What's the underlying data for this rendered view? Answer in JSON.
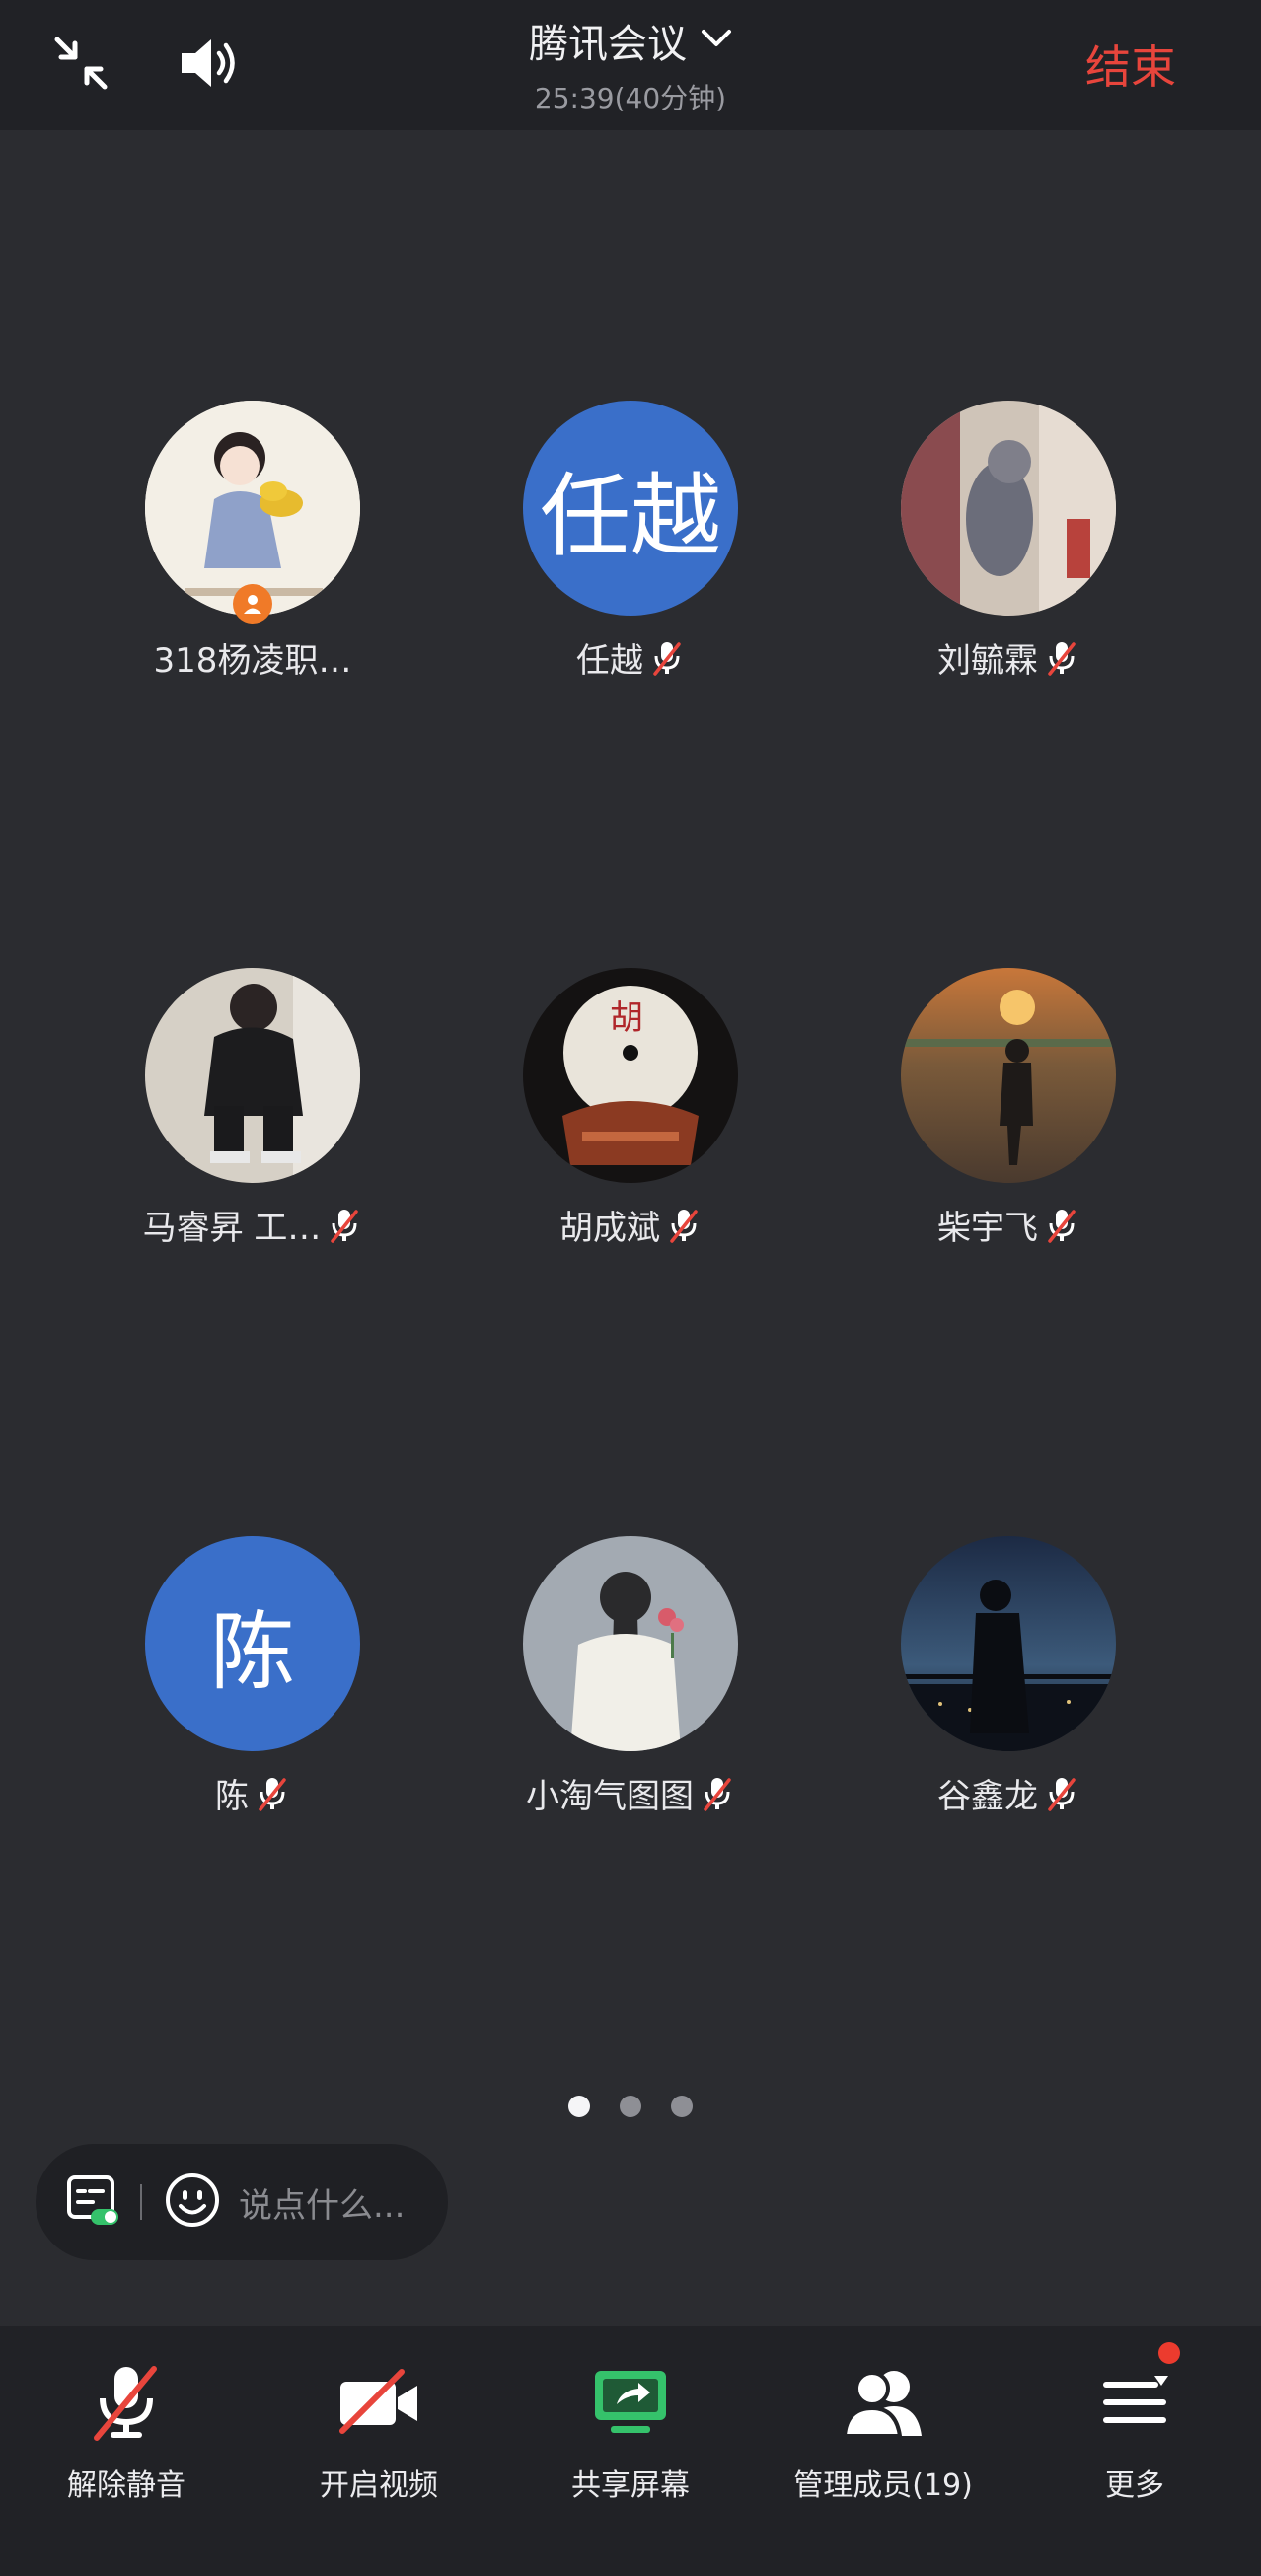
{
  "header": {
    "title": "腾讯会议",
    "duration": "25:39(40分钟)",
    "end_label": "结束"
  },
  "participants": [
    {
      "name": "318杨凌职…",
      "avatar": "photo",
      "avatar_desc": "illustrated girl with gold",
      "muted": false,
      "host": true
    },
    {
      "name": "任越",
      "avatar_text": "任越",
      "muted": true
    },
    {
      "name": "刘毓霖",
      "avatar": "photo",
      "avatar_desc": "cat photo",
      "muted": true
    },
    {
      "name": "马睿昇 工…",
      "avatar": "photo",
      "avatar_desc": "person sitting",
      "muted": true
    },
    {
      "name": "胡成斌",
      "avatar": "photo",
      "avatar_desc": "chinese disc emblem",
      "muted": true
    },
    {
      "name": "柴宇飞",
      "avatar": "photo",
      "avatar_desc": "sunset silhouette",
      "muted": true
    },
    {
      "name": "陈",
      "avatar_text": "陈",
      "muted": true
    },
    {
      "name": "小淘气图图",
      "avatar": "photo",
      "avatar_desc": "girl back view",
      "muted": true
    },
    {
      "name": "谷鑫龙",
      "avatar": "photo",
      "avatar_desc": "night city silhouette",
      "muted": true
    }
  ],
  "pagination": {
    "pages": 3,
    "current": 1
  },
  "chat": {
    "placeholder": "说点什么..."
  },
  "toolbar": {
    "unmute": "解除静音",
    "video": "开启视频",
    "share": "共享屏幕",
    "members": "管理成员(19)",
    "more": "更多"
  },
  "colors": {
    "end": "#e8453c",
    "share_green": "#35c26b",
    "avatar_blue": "#3a6fc9",
    "host_badge": "#f07a28",
    "notify": "#ec3b2e"
  },
  "icons": [
    "minimize-icon",
    "speaker-icon",
    "chevron-down-icon",
    "mic-muted-icon",
    "host-icon",
    "subtitle-icon",
    "emoji-icon",
    "video-off-icon",
    "share-screen-icon",
    "members-icon",
    "menu-icon"
  ]
}
